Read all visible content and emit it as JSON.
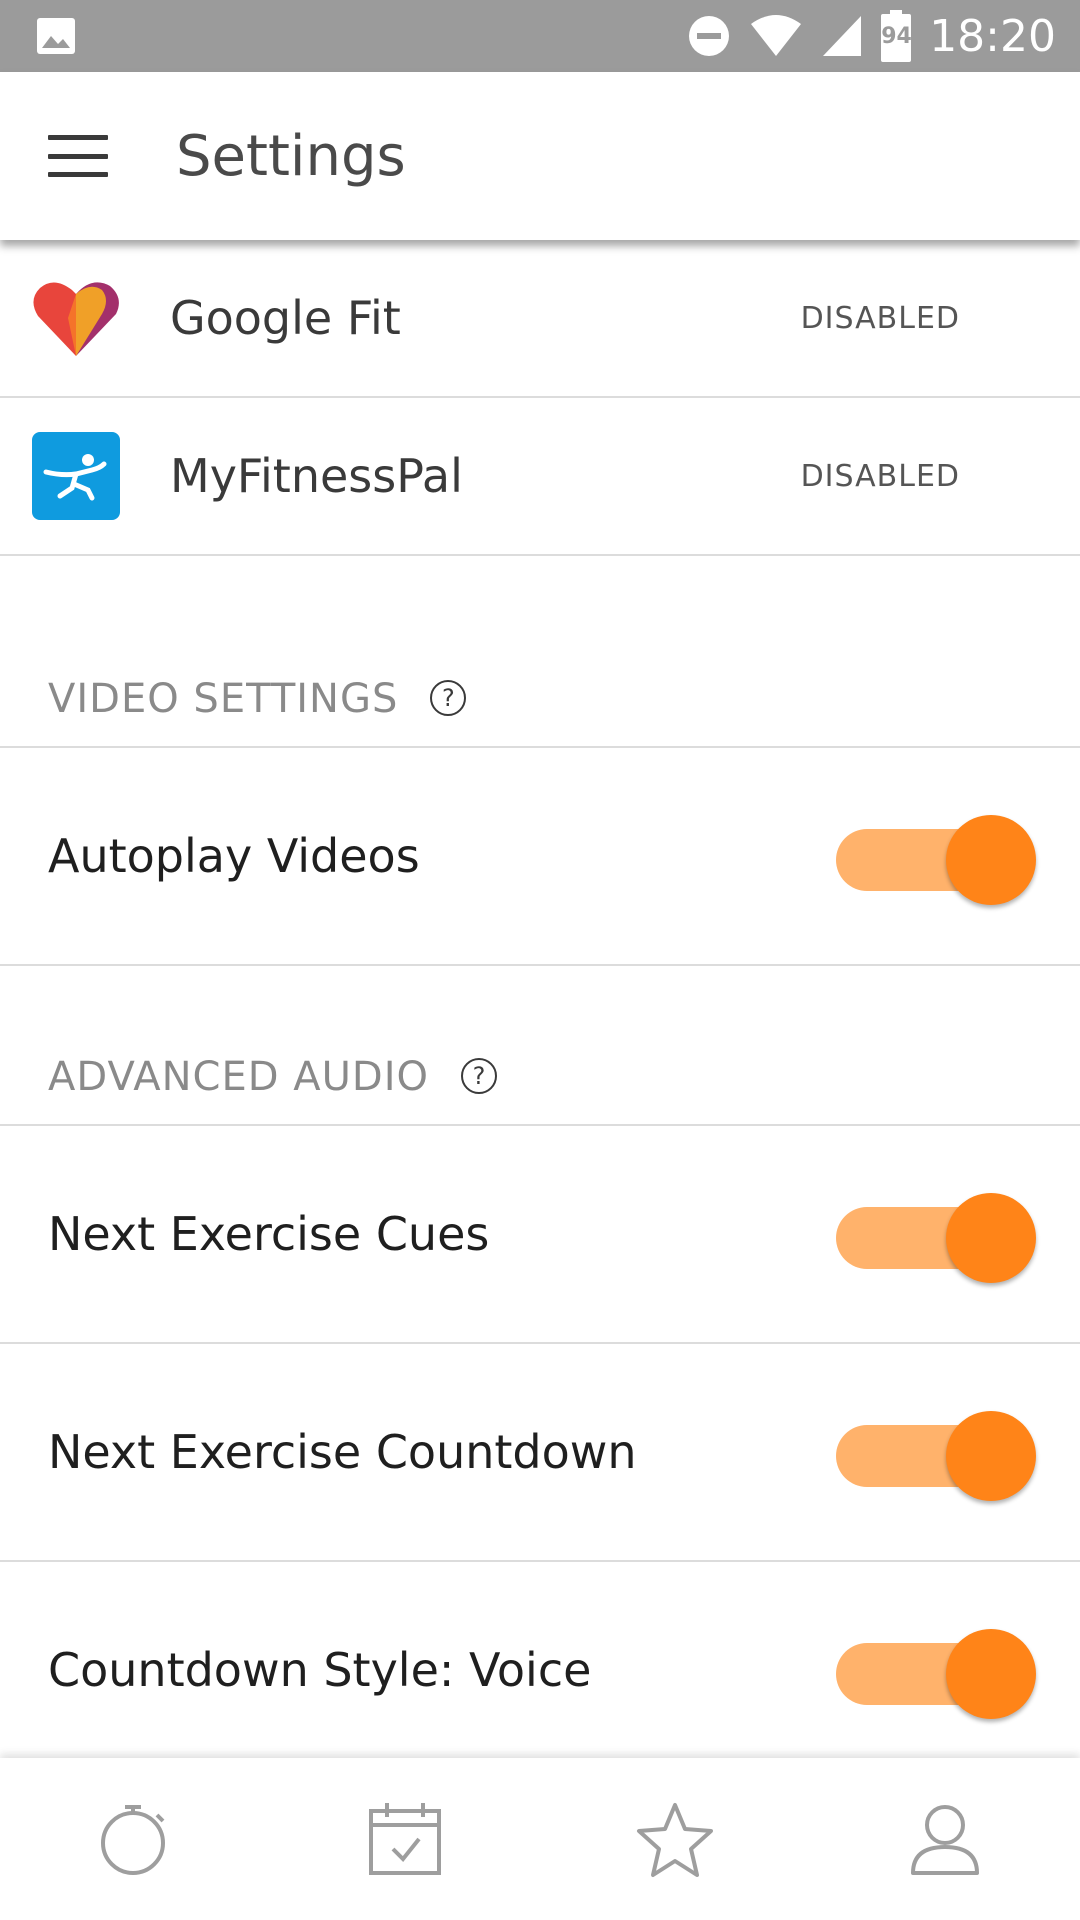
{
  "status_bar": {
    "time": "18:20",
    "battery_level": "94",
    "icons": [
      "image-icon",
      "do-not-disturb-icon",
      "wifi-icon",
      "signal-icon",
      "battery-icon"
    ]
  },
  "app_bar": {
    "title": "Settings",
    "menu_icon": "hamburger-menu-icon"
  },
  "integrations": [
    {
      "name": "Google Fit",
      "status": "DISABLED",
      "icon": "google-fit-icon"
    },
    {
      "name": "MyFitnessPal",
      "status": "DISABLED",
      "icon": "myfitnesspal-icon"
    }
  ],
  "video_settings": {
    "header": "VIDEO SETTINGS",
    "help_glyph": "?",
    "items": [
      {
        "label": "Autoplay Videos",
        "enabled": true
      }
    ]
  },
  "advanced_audio": {
    "header": "ADVANCED AUDIO",
    "help_glyph": "?",
    "items": [
      {
        "label": "Next Exercise Cues",
        "enabled": true
      },
      {
        "label": "Next Exercise Countdown",
        "enabled": true
      },
      {
        "label": "Countdown Style: Voice",
        "enabled": true
      }
    ]
  },
  "bottom_nav": {
    "items": [
      "stopwatch-icon",
      "calendar-check-icon",
      "star-icon",
      "profile-icon"
    ]
  },
  "colors": {
    "status_bar": "#9b9b9b",
    "toggle_track": "#ffb26b",
    "toggle_knob": "#ff8418",
    "divider": "#dcdcdc",
    "section_header": "#8a8a8a"
  }
}
